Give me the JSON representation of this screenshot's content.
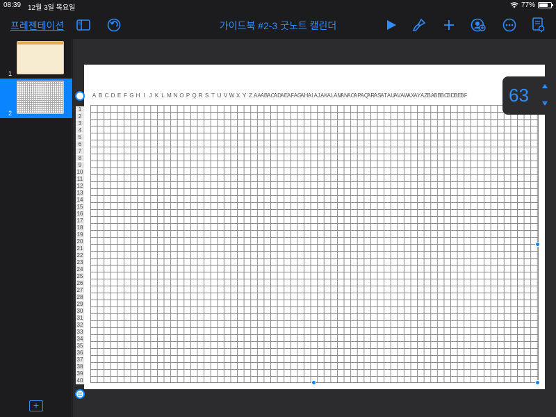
{
  "status_bar": {
    "time": "08:39",
    "date": "12월 3일 목요일",
    "battery": "77%",
    "battery_level": 0.77
  },
  "toolbar": {
    "back_label": "프레젠테이션",
    "title": "가이드북 #2-3 굿노트 캘린더",
    "icons": [
      "sidebar-icon",
      "undo-icon",
      "play-icon",
      "brush-icon",
      "plus-icon",
      "collaborate-icon",
      "more-icon",
      "document-icon"
    ]
  },
  "sidebar": {
    "slides": [
      {
        "number": "1",
        "selected": false
      },
      {
        "number": "2",
        "selected": true
      }
    ]
  },
  "spreadsheet": {
    "columns": [
      "A",
      "B",
      "C",
      "D",
      "E",
      "F",
      "G",
      "H",
      "I",
      "J",
      "K",
      "L",
      "M",
      "N",
      "O",
      "P",
      "Q",
      "R",
      "S",
      "T",
      "U",
      "V",
      "W",
      "X",
      "Y",
      "Z",
      "AA",
      "AB",
      "AC",
      "AD",
      "AE",
      "AF",
      "AG",
      "AH",
      "AI",
      "AJ",
      "AK",
      "AL",
      "AM",
      "AN",
      "AO",
      "AP",
      "AQ",
      "AR",
      "AS",
      "AT",
      "AU",
      "AV",
      "AW",
      "AX",
      "AY",
      "AZ",
      "BA",
      "BB",
      "BC",
      "BD",
      "BE",
      "BF"
    ],
    "rows": [
      "1",
      "2",
      "3",
      "4",
      "5",
      "6",
      "7",
      "8",
      "9",
      "10",
      "11",
      "12",
      "13",
      "14",
      "15",
      "16",
      "17",
      "18",
      "19",
      "20",
      "21",
      "22",
      "23",
      "24",
      "25",
      "26",
      "27",
      "28",
      "29",
      "30",
      "31",
      "32",
      "33",
      "34",
      "35",
      "36",
      "37",
      "38",
      "39",
      "40"
    ]
  },
  "stepper": {
    "value": "63"
  },
  "colors": {
    "accent": "#2f8cff",
    "selected": "#0a84ff",
    "background": "#1c1c1e"
  }
}
